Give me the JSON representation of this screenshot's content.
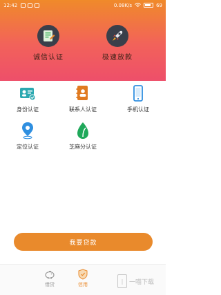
{
  "status_bar": {
    "time": "12:42",
    "network_speed": "0.08",
    "network_unit": "K/s",
    "battery": "69"
  },
  "hero": {
    "items": [
      {
        "label": "诚信认证",
        "icon": "credit-certificate-icon"
      },
      {
        "label": "极速放款",
        "icon": "rocket-icon"
      }
    ]
  },
  "verifications": [
    {
      "label": "身份认证",
      "icon": "id-card-icon",
      "color": "#2ba8b0"
    },
    {
      "label": "联系人认证",
      "icon": "contact-book-icon",
      "color": "#e07a20"
    },
    {
      "label": "手机认证",
      "icon": "mobile-phone-icon",
      "color": "#2f8fe0"
    },
    {
      "label": "定位认证",
      "icon": "location-pin-icon",
      "color": "#2f8fe0"
    },
    {
      "label": "芝麻分认证",
      "icon": "sesame-leaf-icon",
      "color": "#1fa85a"
    }
  ],
  "primary_button": {
    "label": "我要贷款"
  },
  "tabbar": {
    "tabs": [
      {
        "label": "借贷",
        "icon": "piggy-bank-icon",
        "active": false
      },
      {
        "label": "信用",
        "icon": "shield-icon",
        "active": true
      }
    ]
  },
  "watermark": {
    "text": "一喵下载"
  },
  "colors": {
    "accent": "#e98a2c",
    "hero_top": "#f08a2a",
    "hero_bottom": "#ee4f6a"
  }
}
